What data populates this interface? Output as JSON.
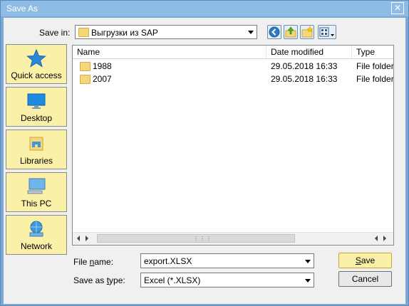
{
  "window": {
    "title": "Save As",
    "close_glyph": "✕"
  },
  "toolbar": {
    "save_in_label": "Save in:",
    "save_in_value": "Выгрузки из SAP",
    "buttons": [
      "back-icon",
      "up-folder-icon",
      "new-folder-icon",
      "view-menu-icon"
    ]
  },
  "places": [
    {
      "label": "Quick access",
      "icon": "quick-access-star-icon"
    },
    {
      "label": "Desktop",
      "icon": "desktop-icon"
    },
    {
      "label": "Libraries",
      "icon": "libraries-icon"
    },
    {
      "label": "This PC",
      "icon": "this-pc-icon"
    },
    {
      "label": "Network",
      "icon": "network-icon"
    }
  ],
  "list": {
    "columns": [
      "Name",
      "Date modified",
      "Type"
    ],
    "rows": [
      {
        "name": "1988",
        "date": "29.05.2018 16:33",
        "type": "File folder"
      },
      {
        "name": "2007",
        "date": "29.05.2018 16:33",
        "type": "File folder"
      }
    ]
  },
  "form": {
    "file_name_label_pre": "File ",
    "file_name_label_key": "n",
    "file_name_label_post": "ame:",
    "file_name_value": "export.XLSX",
    "save_type_label_pre": "Save as ",
    "save_type_label_key": "t",
    "save_type_label_post": "ype:",
    "save_type_value": "Excel (*.XLSX)"
  },
  "buttons": {
    "save_key": "S",
    "save_rest": "ave",
    "cancel": "Cancel"
  },
  "colors": {
    "accent": "#8fbce6",
    "place_bg": "#fbf0a8",
    "folder": "#f5d77a"
  }
}
